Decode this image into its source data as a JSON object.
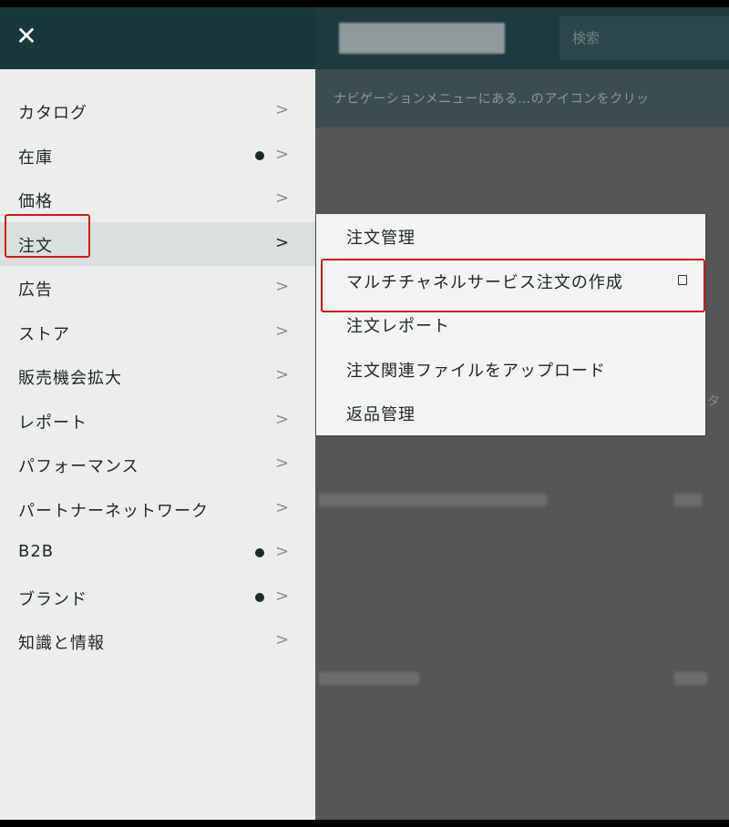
{
  "header": {
    "close_icon": "close-icon",
    "search_placeholder": "検索"
  },
  "background": {
    "subbar_text": "ナビゲーションメニューにある…のアイコンをクリッ",
    "edge_text": "ータ"
  },
  "nav": {
    "items": [
      {
        "label": "カタログ",
        "dot": false
      },
      {
        "label": "在庫",
        "dot": true
      },
      {
        "label": "価格",
        "dot": false
      },
      {
        "label": "注文",
        "dot": false,
        "active": true
      },
      {
        "label": "広告",
        "dot": false
      },
      {
        "label": "ストア",
        "dot": false
      },
      {
        "label": "販売機会拡大",
        "dot": false
      },
      {
        "label": "レポート",
        "dot": false
      },
      {
        "label": "パフォーマンス",
        "dot": false
      },
      {
        "label": "パートナーネットワーク",
        "dot": false
      },
      {
        "label": "B2B",
        "dot": true
      },
      {
        "label": "ブランド",
        "dot": true
      },
      {
        "label": "知識と情報",
        "dot": false
      }
    ],
    "chevron": ">"
  },
  "submenu": {
    "items": [
      {
        "label": "注文管理"
      },
      {
        "label": "マルチチャネルサービス注文の作成",
        "pin": true
      },
      {
        "label": "注文レポート"
      },
      {
        "label": "注文関連ファイルをアップロード"
      },
      {
        "label": "返品管理"
      }
    ]
  },
  "colors": {
    "highlight": "#d41717",
    "nav_bg": "#eceeee",
    "header_bg": "#15383d"
  }
}
